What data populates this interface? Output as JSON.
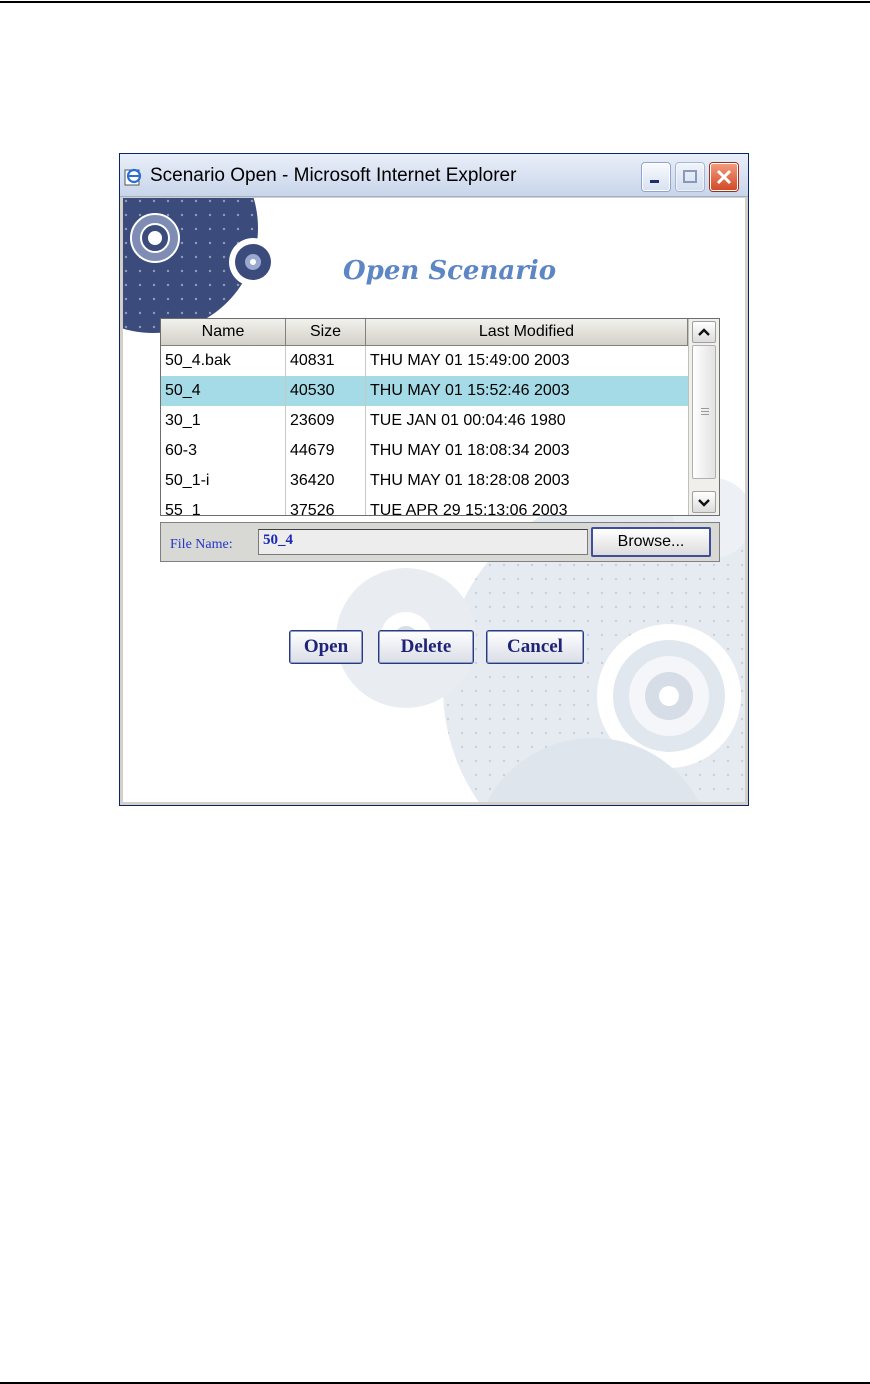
{
  "window": {
    "title": "Scenario Open - Microsoft Internet Explorer"
  },
  "dialog": {
    "heading": "Open Scenario"
  },
  "table": {
    "headers": [
      "Name",
      "Size",
      "Last Modified"
    ],
    "rows": [
      {
        "name": "50_4.bak",
        "size": "40831",
        "modified": "THU MAY 01 15:49:00 2003"
      },
      {
        "name": "50_4",
        "size": "40530",
        "modified": "THU MAY 01 15:52:46 2003"
      },
      {
        "name": "30_1",
        "size": "23609",
        "modified": "TUE JAN 01 00:04:46 1980"
      },
      {
        "name": "60-3",
        "size": "44679",
        "modified": "THU MAY 01 18:08:34 2003"
      },
      {
        "name": "50_1-i",
        "size": "36420",
        "modified": "THU MAY 01 18:28:08 2003"
      },
      {
        "name": "55_1",
        "size": "37526",
        "modified": "TUE APR 29 15:13:06 2003"
      }
    ],
    "selected_row": "50_4",
    "selected_color": "#a4dbe6"
  },
  "file_bar": {
    "label": "File Name:",
    "value": "50_4",
    "browse_label": "Browse..."
  },
  "actions": {
    "open_label": "Open",
    "delete_label": "Delete",
    "cancel_label": "Cancel"
  },
  "colors": {
    "heading": "#5d86c5",
    "button_text": "#1f2478",
    "file_label": "#2437c8"
  },
  "icons": [
    "ie-icon",
    "minimize-icon",
    "maximize-icon",
    "close-icon",
    "scroll-up-icon",
    "scroll-down-icon"
  ]
}
